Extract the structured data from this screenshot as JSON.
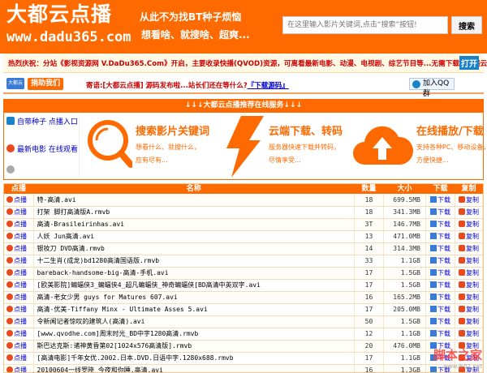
{
  "header": {
    "logo_cn": "大都云点播",
    "logo_url": "www.dadu365.com",
    "slogan_line1": "从此不为找BT种子烦恼",
    "slogan_line2": "想看啥、就搜啥、超爽...",
    "search_placeholder": "在这里输入影片关键词,点击“搜索”按钮!",
    "search_button": "搜索"
  },
  "notice": {
    "text": "热烈庆祝：分站《影视资源网 V.DaDu365.Com》开启，主要收录快播(QVOD)资源，可离看最新电影、动漫、电视剧、综艺节目等...无需下载，在线云点播。",
    "button": "打开"
  },
  "bar2": {
    "ext_label": "大都云",
    "donate": "捐助我们",
    "text_prefix": "寄语:[大都云点播] 源码发布啦...站长们还在等什么?",
    "link": "『下载源码』",
    "qq_button": "加入QQ群"
  },
  "banner": {
    "title": "↓↓↓大都云点播推荐在线服务↓↓↓",
    "side_links": [
      "自带种子 点播入口",
      "最新电影 在线观看",
      ""
    ],
    "features": [
      {
        "title": "搜索影片关键词",
        "desc1": "想看什么、就搜什么，",
        "desc2": "应有尽有..."
      },
      {
        "title": "云端下载、转码",
        "desc1": "服务器快速下载并转码，",
        "desc2": "尽情享受..."
      },
      {
        "title": "在线播放/下载",
        "desc1": "支持各种PC、移动设备，",
        "desc2": "方便快捷..."
      }
    ]
  },
  "table": {
    "headers": {
      "play": "点播",
      "name": "名称",
      "count": "数量",
      "size": "大小",
      "download": "下载",
      "copy": "复制"
    },
    "play_label": "点播",
    "download_label": "下载",
    "copy_label": "复制",
    "rows": [
      {
        "name": "特-高清.avi",
        "count": "18",
        "size": "699.5MB"
      },
      {
        "name": "打架 脚打高清版A.rmvb",
        "count": "18",
        "size": "341.3MB"
      },
      {
        "name": "高清-Brasileirinhas.avi",
        "count": "3T",
        "size": "146.7MB"
      },
      {
        "name": "人妖 Jun高清.avi",
        "count": "13",
        "size": "471.0MB"
      },
      {
        "name": "银妆刀 DVD高清.rmvb",
        "count": "14",
        "size": "314.3MB"
      },
      {
        "name": "十二生肖(成龙)bd1280高清国语版.rmvb",
        "count": "33",
        "size": "1.1GB"
      },
      {
        "name": "bareback-handsome-big-高清-手机.avi",
        "count": "17",
        "size": "1.5GB"
      },
      {
        "name": "[欧美影院]蝙蝠侠3_蝙蝠侠4_超凡蝙蝠侠_神奇蝙蝠侠[BD高清中英双字.avi",
        "count": "17",
        "size": "1.5GB"
      },
      {
        "name": "高清-老女少男 guys for Matures 607.avi",
        "count": "16",
        "size": "165.2MB"
      },
      {
        "name": "高清-优美-Tiffany Minx - Ultimate Asses 5.avi",
        "count": "17",
        "size": "205.0MB"
      },
      {
        "name": "令新闻记者惊叹的建筑人(高清).avi",
        "count": "50",
        "size": "1.5GB"
      },
      {
        "name": "[www.qvodhe.com]周末时光_BD中字1280高清.rmvb",
        "count": "12",
        "size": "1.1GB"
      },
      {
        "name": "斯巴达克斯:诸神黄昏第02[1024x576高清版].rmvb",
        "count": "20",
        "size": "476.0MB"
      },
      {
        "name": "[高清电影]千年女优.2002.日本.DVD.日语中字.1280x688.rmvb",
        "count": "17",
        "size": "1.1GB"
      },
      {
        "name": "20100604一线罗晓 今夜和你睡.高清.avi",
        "count": "16",
        "size": "1.3GB"
      }
    ]
  },
  "watermark": {
    "text": "脚本之家",
    "sub": "www.jb51.net"
  },
  "colors": {
    "brand": "#ff6a00",
    "link": "#0000cc",
    "notice_red": "#cc0000"
  }
}
